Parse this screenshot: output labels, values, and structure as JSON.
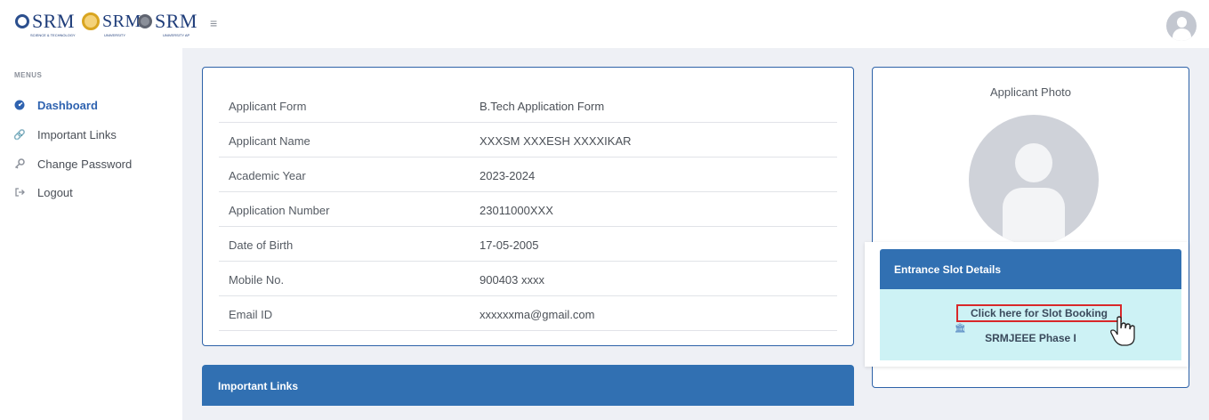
{
  "header": {
    "logos": [
      {
        "text": "SRM",
        "sub": "SCIENCE & TECHNOLOGY"
      },
      {
        "text": "SRM",
        "sub": "UNIVERSITY"
      },
      {
        "text": "SRM",
        "sub": "UNIVERSITY AP"
      }
    ],
    "menu_icon": "hamburger-icon",
    "avatar_icon": "user-avatar-icon"
  },
  "sidebar": {
    "section_label": "MENUS",
    "items": [
      {
        "label": "Dashboard",
        "icon": "dashboard-icon",
        "active": true
      },
      {
        "label": "Important Links",
        "icon": "link-icon",
        "active": false
      },
      {
        "label": "Change Password",
        "icon": "key-icon",
        "active": false
      },
      {
        "label": "Logout",
        "icon": "logout-icon",
        "active": false
      }
    ]
  },
  "applicant": {
    "rows": [
      {
        "label": "Applicant Form",
        "value": "B.Tech Application Form"
      },
      {
        "label": "Applicant Name",
        "value": "XXXSM XXXESH XXXXIKAR"
      },
      {
        "label": "Academic Year",
        "value": "2023-2024"
      },
      {
        "label": "Application Number",
        "value": "23011000XXX"
      },
      {
        "label": "Date of Birth",
        "value": "17-05-2005"
      },
      {
        "label": "Mobile No.",
        "value": "900403 xxxx"
      },
      {
        "label": "Email ID",
        "value": "xxxxxxma@gmail.com"
      }
    ]
  },
  "important_links": {
    "title": "Important Links"
  },
  "photo": {
    "label": "Applicant Photo"
  },
  "slot": {
    "title": "Entrance Slot Details",
    "link_label": "Click here for Slot Booking",
    "phase": "SRMJEEE Phase I"
  },
  "colors": {
    "accent": "#3170b2",
    "highlight_box": "#d8282a",
    "slot_bg": "#cdf2f5"
  }
}
